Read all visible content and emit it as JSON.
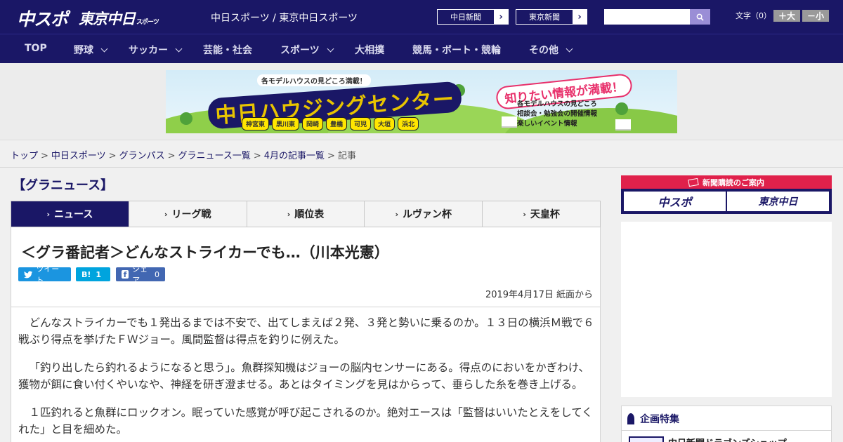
{
  "header": {
    "logo_chuspo": "中スポ",
    "logo_tokyo": "東京中日",
    "logo_tokyo_small": "スポーツ",
    "site_name": "中日スポーツ / 東京中日スポーツ",
    "links": [
      "中日新聞",
      "東京新聞"
    ],
    "search_placeholder": "",
    "font_size_label": "文字（0）",
    "font_larger": "＋大",
    "font_smaller": "－小"
  },
  "nav": {
    "items": [
      {
        "label": "TOP",
        "has_dropdown": false
      },
      {
        "label": "野球",
        "has_dropdown": true
      },
      {
        "label": "サッカー",
        "has_dropdown": true
      },
      {
        "label": "芸能・社会",
        "has_dropdown": false
      },
      {
        "label": "スポーツ",
        "has_dropdown": true
      },
      {
        "label": "大相撲",
        "has_dropdown": false
      },
      {
        "label": "競馬・ボート・競輪",
        "has_dropdown": false
      },
      {
        "label": "その他",
        "has_dropdown": true
      }
    ]
  },
  "banner": {
    "top_copy": "各モデルハウスの見どころ満載！",
    "main_copy": "中日ハウジングセンター",
    "bubble": "知りたい情報が満載！",
    "info": [
      "各モデルハウスの見どころ",
      "相談会・勉強会の開催情報",
      "楽しいイベント情報"
    ],
    "cities": [
      "神宮東",
      "黒川東",
      "岡崎",
      "豊橋",
      "可児",
      "大垣",
      "浜北"
    ]
  },
  "breadcrumb": {
    "items": [
      "トップ",
      "中日スポーツ",
      "グランパス",
      "グラニュース一覧",
      "4月の記事一覧"
    ],
    "current": "記事"
  },
  "section_title": "【グラニュース】",
  "tabs": [
    {
      "label": "ニュース",
      "active": true
    },
    {
      "label": "リーグ戦",
      "active": false
    },
    {
      "label": "順位表",
      "active": false
    },
    {
      "label": "ルヴァン杯",
      "active": false
    },
    {
      "label": "天皇杯",
      "active": false
    }
  ],
  "article": {
    "headline": "＜グラ番記者＞どんなストライカーでも…（川本光憲）",
    "share": {
      "tweet": "ツイート",
      "hatena_count": "1",
      "facebook": "シェア",
      "facebook_count": "0"
    },
    "dateline": "2019年4月17日 紙面から",
    "paragraphs": [
      "どんなストライカーでも１発出るまでは不安で、出てしまえば２発、３発と勢いに乗るのか。１３日の横浜Ｍ戦で６戦ぶり得点を挙げたＦＷジョー。風間監督は得点を釣りに例えた。",
      "「釣り出したら釣れるようになると思う」。魚群探知機はジョーの脳内センサーにある。得点のにおいをかぎわけ、獲物が餌に食い付くやいなや、神経を研ぎ澄ませる。あとはタイミングを見はからって、垂らした糸を巻き上げる。",
      "１匹釣れると魚群にロックオン。眠っていた感覚が呼び起こされるのか。絶対エースは「監督はいいたとえをしてくれた」と目を細めた。"
    ]
  },
  "sidebar": {
    "subscribe_head": "新聞購読のご案内",
    "subscribe_chuspo": "中スポ",
    "subscribe_tokyo": "東京中日",
    "feature_title": "企画特集",
    "feature_item": "中日新聞ドラゴンズショップ"
  },
  "colors": {
    "brand_navy": "#1a1766",
    "accent_red": "#e0214b"
  }
}
